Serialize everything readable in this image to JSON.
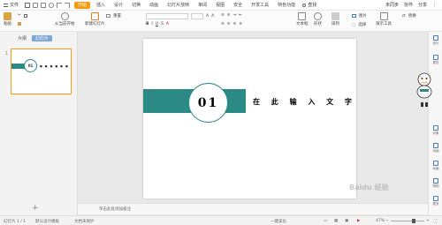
{
  "menubar": {
    "file_label": "文件",
    "tabs": [
      "开始",
      "插入",
      "设计",
      "切换",
      "动画",
      "幻灯片放映",
      "审阅",
      "视图",
      "安全",
      "开发工具",
      "特色功能"
    ],
    "active_tab_index": 0,
    "search_label": "查找",
    "right_items": [
      "未同步",
      "协作",
      "分享"
    ]
  },
  "ribbon": {
    "paste": "粘贴",
    "start_from_current": "从当前开始",
    "new_slide": "新建幻灯片",
    "reset": "重置",
    "textbox": "文本框",
    "shape": "形状",
    "arrange": "排列",
    "replace": "替换",
    "picture": "图片",
    "select": "选择",
    "play": "演示工具"
  },
  "left_panel": {
    "tabs": [
      "大纲",
      "幻灯片"
    ],
    "active_tab_index": 1,
    "thumb_number": "1",
    "thumb_circle_text": "01",
    "thumb_dots": "■ ■ ■ ■ ■ ■",
    "add_label": "+"
  },
  "slide": {
    "circle_text": "01",
    "title_text": "在 此 输 入 文 字"
  },
  "notes": {
    "placeholder": "单击此处添加备注"
  },
  "right_sidebar": {
    "items": [
      "设计",
      "属性",
      "对象",
      "动画",
      "动画",
      "帮助",
      "更多",
      "形状",
      "帮助"
    ]
  },
  "statusbar": {
    "slide_count": "幻灯片 1 / 1",
    "theme": "默认设计模板",
    "protection": "文档未保护",
    "notes_toggle": "一键美化",
    "zoom": "47%"
  },
  "colors": {
    "accent": "#f39c12",
    "teal": "#2c8a86"
  },
  "watermark": "Baidu 经验"
}
